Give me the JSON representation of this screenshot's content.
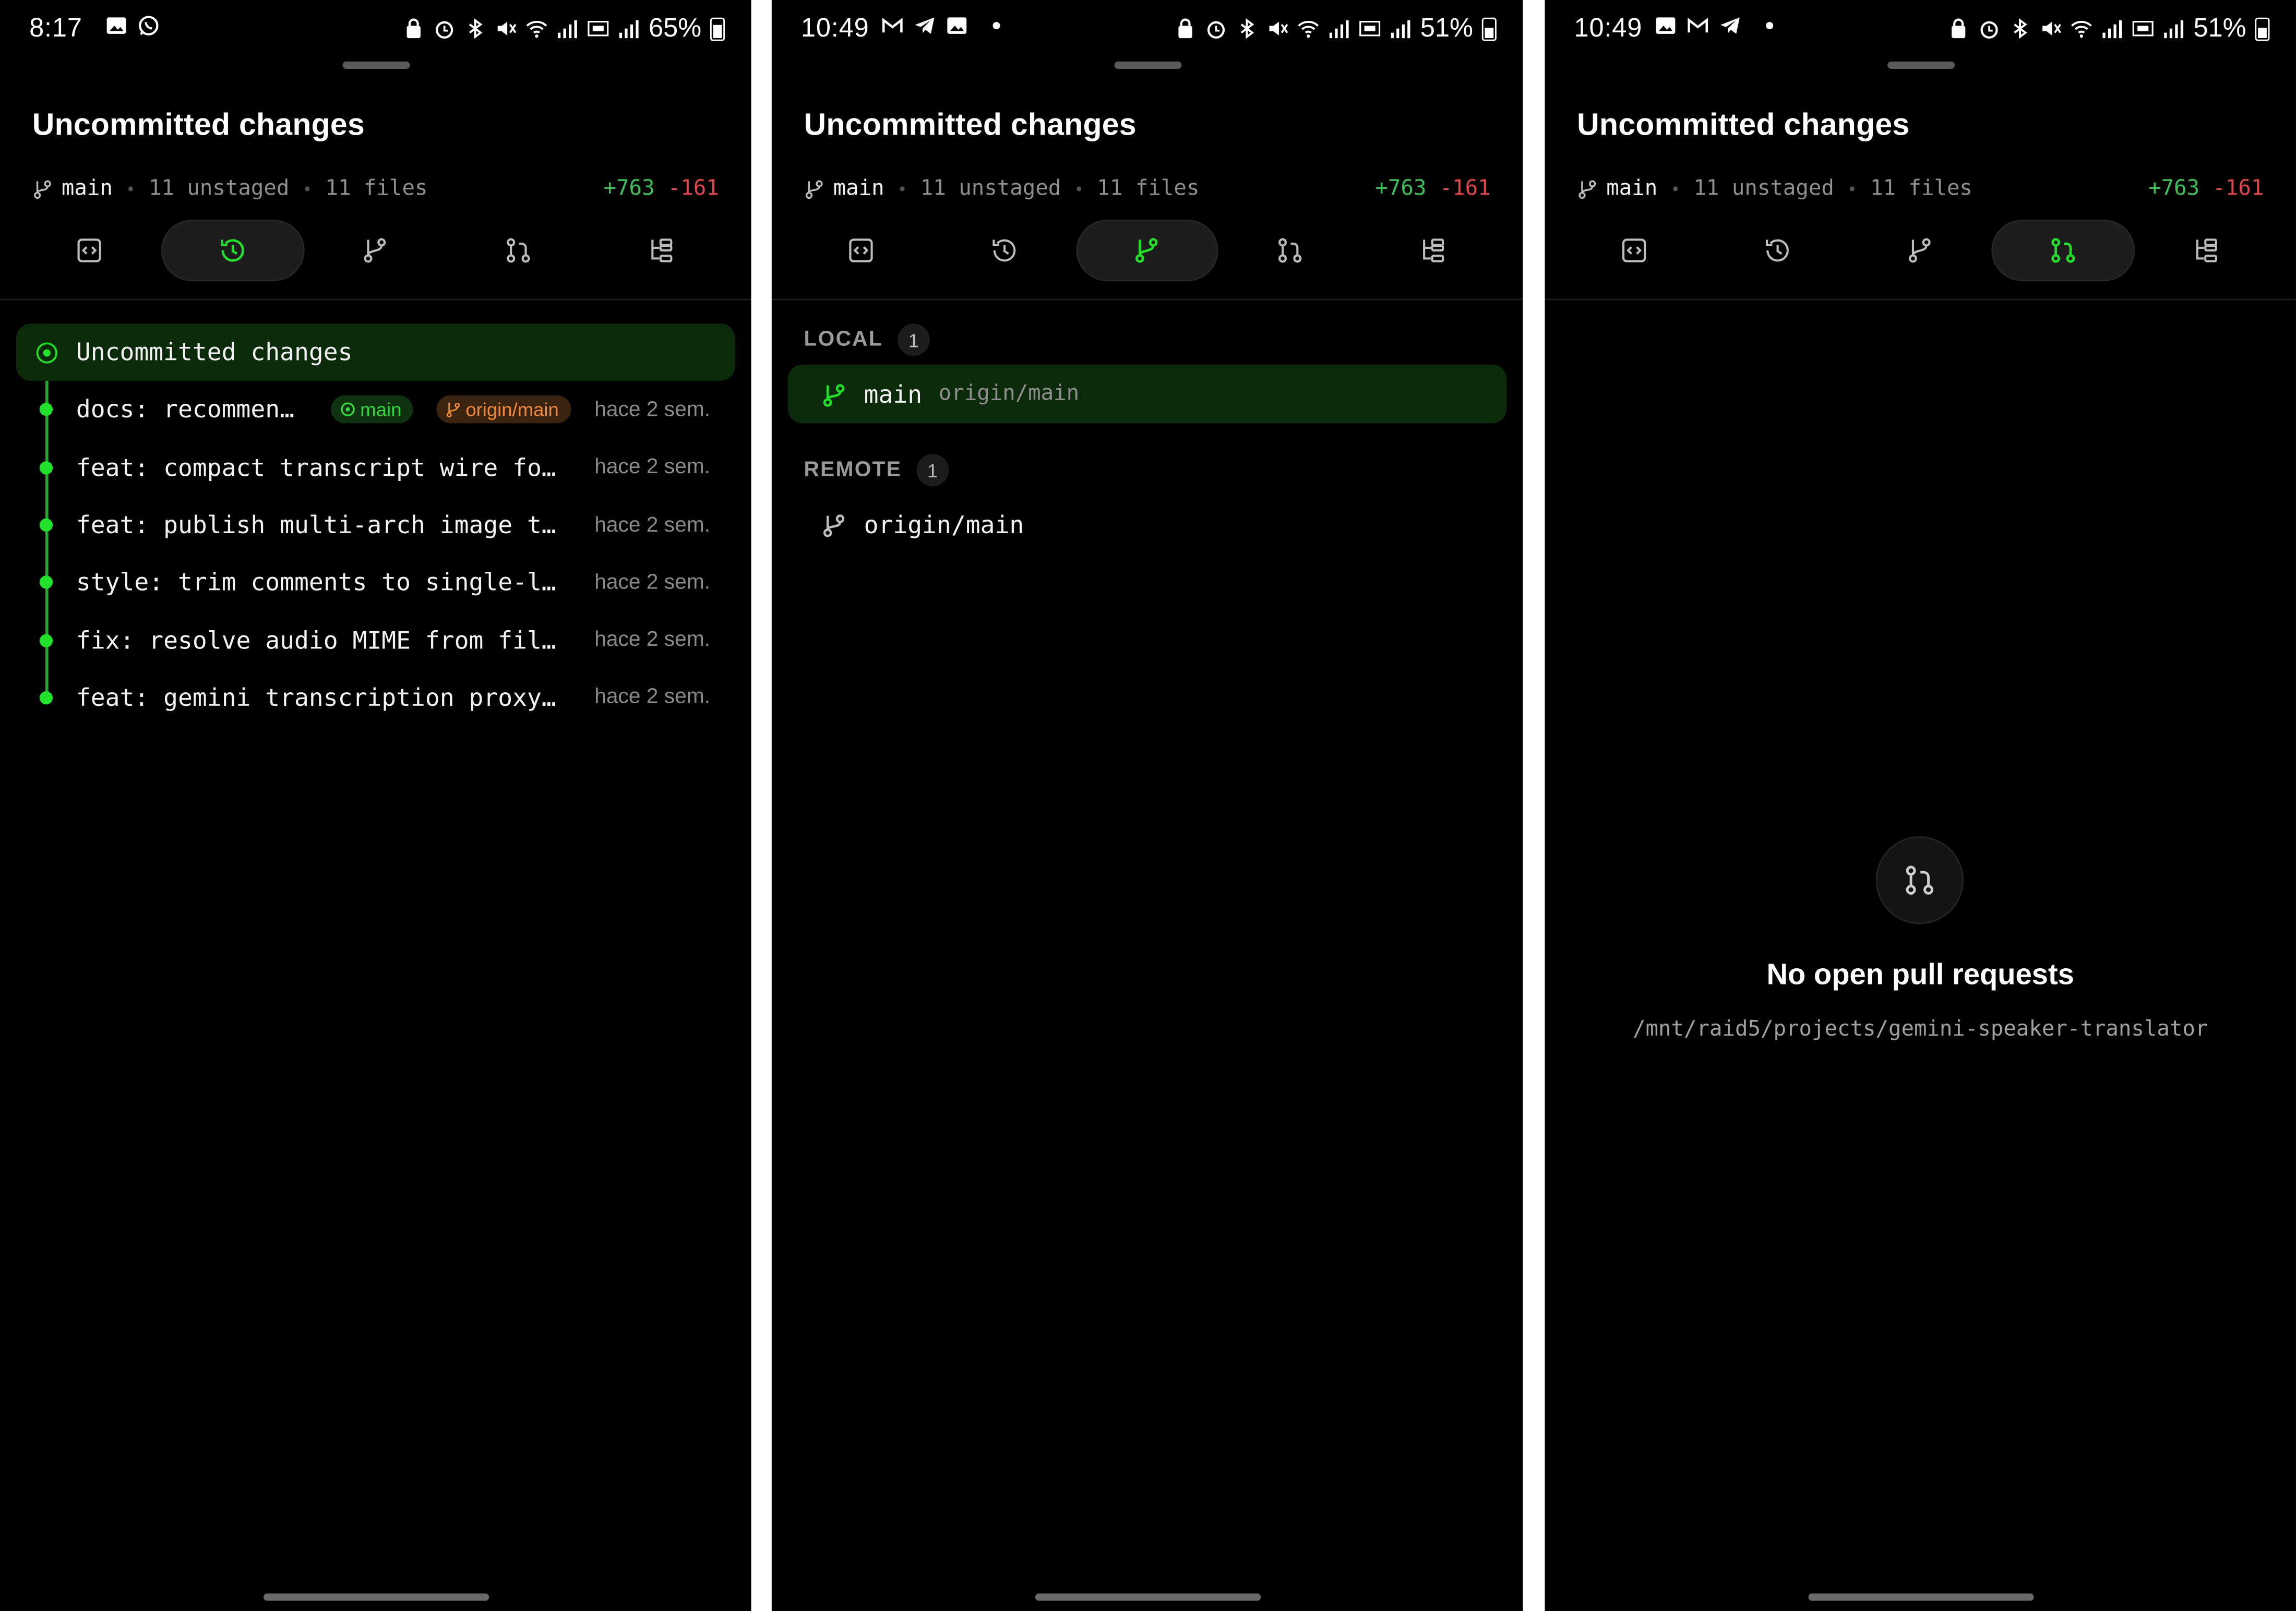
{
  "colors": {
    "accent_green": "#22e12a",
    "additions": "#3ec15a",
    "deletions": "#e0474c",
    "remote_badge": "#f08a3a"
  },
  "panels": [
    {
      "status": {
        "time": "8:17",
        "battery": "65%",
        "left_icons": [
          "gallery-icon",
          "whatsapp-icon"
        ]
      },
      "title": "Uncommitted changes",
      "meta": {
        "branch": "main",
        "unstaged": "11 unstaged",
        "files": "11 files",
        "additions": "+763",
        "deletions": "-161"
      },
      "active_tab": "history",
      "history": {
        "head_label": "Uncommitted changes",
        "commits": [
          {
            "message": "docs: recommen…",
            "local_badge": "main",
            "remote_badge": "origin/main",
            "when": "hace 2 sem."
          },
          {
            "message": "feat: compact transcript wire fo…",
            "when": "hace 2 sem."
          },
          {
            "message": "feat: publish multi-arch image t…",
            "when": "hace 2 sem."
          },
          {
            "message": "style: trim comments to single-l…",
            "when": "hace 2 sem."
          },
          {
            "message": "fix: resolve audio MIME from fil…",
            "when": "hace 2 sem."
          },
          {
            "message": "feat: gemini transcription proxy…",
            "when": "hace 2 sem."
          }
        ]
      }
    },
    {
      "status": {
        "time": "10:49",
        "battery": "51%",
        "left_icons": [
          "gmail-icon",
          "telegram-icon",
          "gallery-icon"
        ]
      },
      "title": "Uncommitted changes",
      "meta": {
        "branch": "main",
        "unstaged": "11 unstaged",
        "files": "11 files",
        "additions": "+763",
        "deletions": "-161"
      },
      "active_tab": "branches",
      "branches": {
        "local_label": "LOCAL",
        "local_count": "1",
        "local": [
          {
            "name": "main",
            "upstream": "origin/main"
          }
        ],
        "remote_label": "REMOTE",
        "remote_count": "1",
        "remote": [
          {
            "name": "origin/main"
          }
        ]
      }
    },
    {
      "status": {
        "time": "10:49",
        "battery": "51%",
        "left_icons": [
          "gallery-icon",
          "gmail-icon",
          "telegram-icon"
        ]
      },
      "title": "Uncommitted changes",
      "meta": {
        "branch": "main",
        "unstaged": "11 unstaged",
        "files": "11 files",
        "additions": "+763",
        "deletions": "-161"
      },
      "active_tab": "pull-requests",
      "pull_requests": {
        "empty_title": "No open pull requests",
        "repo_path": "/mnt/raid5/projects/gemini-speaker-translator"
      }
    }
  ]
}
